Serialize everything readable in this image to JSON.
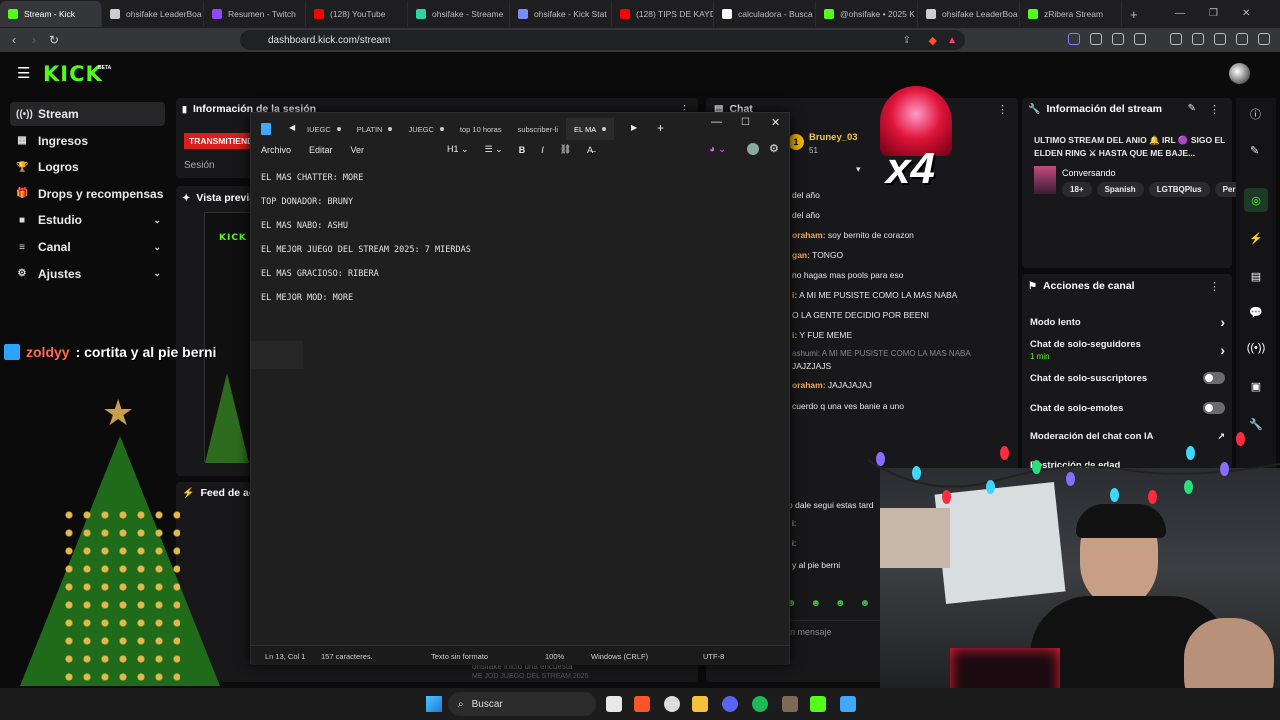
{
  "browser": {
    "tabs": [
      {
        "label": "Stream - Kick",
        "color": "#53fc18",
        "active": true
      },
      {
        "label": "ohsifake LeaderBoa",
        "color": "#cccccc"
      },
      {
        "label": "Resumen - Twitch",
        "color": "#9146ff"
      },
      {
        "label": "(128) YouTube",
        "color": "#ff0000"
      },
      {
        "label": "ohsifake - Streame",
        "color": "#2bd4a3"
      },
      {
        "label": "ohsifake - Kick Stat",
        "color": "#7b8cff"
      },
      {
        "label": "(128) TIPS DE KAYD",
        "color": "#ff0000"
      },
      {
        "label": "calculadora - Busca",
        "color": "#ffffff"
      },
      {
        "label": "@ohsifake • 2025 K",
        "color": "#53fc18"
      },
      {
        "label": "ohsifake LeaderBoa",
        "color": "#cccccc"
      },
      {
        "label": "zRibera Stream",
        "color": "#53fc18"
      }
    ],
    "url": "dashboard.kick.com/stream"
  },
  "kick": {
    "logo": "KICK",
    "logo_badge": "BETA",
    "sidebar": [
      {
        "label": "Stream",
        "icon": "broadcast-icon",
        "glyph": "((•))",
        "chevron": false,
        "active": true
      },
      {
        "label": "Ingresos",
        "icon": "grid-icon",
        "glyph": "▦",
        "chevron": false
      },
      {
        "label": "Logros",
        "icon": "trophy-icon",
        "glyph": "🏆",
        "chevron": false
      },
      {
        "label": "Drops y recompensas",
        "icon": "gift-icon",
        "glyph": "🎁",
        "chevron": false
      },
      {
        "label": "Estudio",
        "icon": "camera-icon",
        "glyph": "■",
        "chevron": true
      },
      {
        "label": "Canal",
        "icon": "channel-icon",
        "glyph": "≡",
        "chevron": true
      },
      {
        "label": "Ajustes",
        "icon": "gear-icon",
        "glyph": "⚙",
        "chevron": true
      }
    ],
    "session": {
      "title": "Información de la sesión",
      "badge": "TRANSMITIENDO",
      "label": "Sesión"
    },
    "preview": {
      "title": "Vista previa"
    },
    "feed": {
      "title": "Feed de actividad",
      "item": "ohsifake inició una encuesta",
      "subitem": "ME JOD JUEGO DEL STREAM 2025"
    },
    "chat": {
      "title": "Chat",
      "top_user": "Bruney_03",
      "top_amount": "51",
      "multiplier": "x4",
      "messages": [
        {
          "user": "",
          "text": "del año"
        },
        {
          "user": "",
          "text": "del año"
        },
        {
          "user": "oraham:",
          "text": " soy bernito de corazon"
        },
        {
          "user": "gan:",
          "text": " TONGO"
        },
        {
          "user": "",
          "text": "no hagas mas pools para eso"
        },
        {
          "user": "i:",
          "text": " A MI ME PUSISTE COMO LA MAS NABA"
        },
        {
          "user": "",
          "text": "O LA GENTE DECIDIO POR BEENI"
        },
        {
          "user": "i:",
          "text": " Y FUE MEME"
        },
        {
          "user": "ashumi:",
          "text": " A MI ME PUSISTE COMO LA MAS NABA"
        },
        {
          "user": "",
          "text": "JAJZJAJS"
        },
        {
          "user": "oraham:",
          "text": " JAJAJAJAJ"
        },
        {
          "user": "",
          "text": "cuerdo q una ves banie a uno"
        }
      ],
      "lower_messages": [
        {
          "text": "o dale segui estas tard"
        },
        {
          "text": "i:"
        },
        {
          "text": "i:"
        },
        {
          "text": "y al pie berni"
        }
      ],
      "placeholder": "n mensaje"
    },
    "stream_info": {
      "title": "Información del stream",
      "stream_title": "ULTIMO STREAM DEL ANIO 🔔 IRL 🟣 SIGO EL ELDEN RING ⚔ HASTA QUE ME BAJE...",
      "category": "Conversando",
      "tags": [
        "18+",
        "Spanish",
        "LGTBQPlus",
        "Perú"
      ]
    },
    "channel_actions": {
      "title": "Acciones de canal",
      "rows": [
        {
          "label": "Modo lento",
          "sub": "",
          "control": "chevron"
        },
        {
          "label": "Chat de solo-seguidores",
          "sub": "1 min",
          "control": "chevron"
        },
        {
          "label": "Chat de solo-suscriptores",
          "sub": "",
          "control": "toggle"
        },
        {
          "label": "Chat de solo-emotes",
          "sub": "",
          "control": "toggle"
        },
        {
          "label": "Moderación del chat con IA",
          "sub": "",
          "control": "external"
        },
        {
          "label": "Restricción de edad",
          "sub": "",
          "control": "none"
        }
      ]
    },
    "overlay_msg": {
      "user": "zoldyy",
      "text": " : cortita y al pie berni"
    }
  },
  "notepad": {
    "tabs": [
      "IUEGC",
      "PLATIN",
      "JUEGC",
      "top 10 horas",
      "subscriber-li",
      "EL MA"
    ],
    "menu": [
      "Archivo",
      "Editar",
      "Ver"
    ],
    "heading_select": "H1",
    "lines": [
      "EL MAS CHATTER: MORE",
      "TOP DONADOR: BRUNY",
      "EL MAS NABO: ASHU",
      "EL MEJOR JUEGO DEL STREAM 2025: 7 MIERDAS",
      "EL MAS GRACIOSO: RIBERA",
      "EL MEJOR MOD: MORE"
    ],
    "status": {
      "position": "Ln 13, Col 1",
      "chars": "157 caracteres.",
      "format": "Texto sin formato",
      "zoom": "100%",
      "eol": "Windows (CRLF)",
      "encoding": "UTF-8"
    }
  },
  "taskbar": {
    "search": "Buscar"
  }
}
